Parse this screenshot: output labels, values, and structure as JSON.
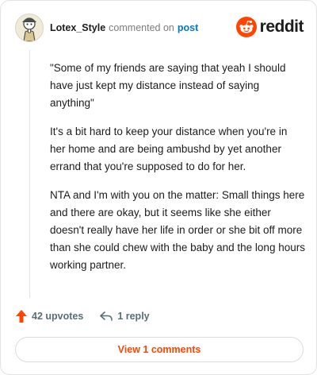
{
  "comment": {
    "username": "Lotex_Style",
    "action_text": "commented on",
    "target_link": "post",
    "paragraphs": [
      "\"Some of my friends are saying that yeah I should have just kept my distance instead of saying anything\"",
      "It's a bit hard to keep your distance when you're in her home and are being ambushd by yet another errand that you're supposed to do for her.",
      "NTA and I'm with you on the matter: Small things here and there are okay, but it seems like she either doesn't really have her life in order or she bit off more than she could chew with the baby and the long hours working partner."
    ]
  },
  "brand": {
    "name": "reddit",
    "icon": "reddit-logo-icon",
    "color": "#ff4500"
  },
  "actions": {
    "upvotes": "42 upvotes",
    "upvote_icon": "upvote-arrow-icon",
    "replies": "1 reply",
    "reply_icon": "reply-arrow-icon"
  },
  "view_button": "View 1 comments",
  "colors": {
    "accent": "#ff4500",
    "link": "#0079d3",
    "muted": "#7c7c7c"
  }
}
